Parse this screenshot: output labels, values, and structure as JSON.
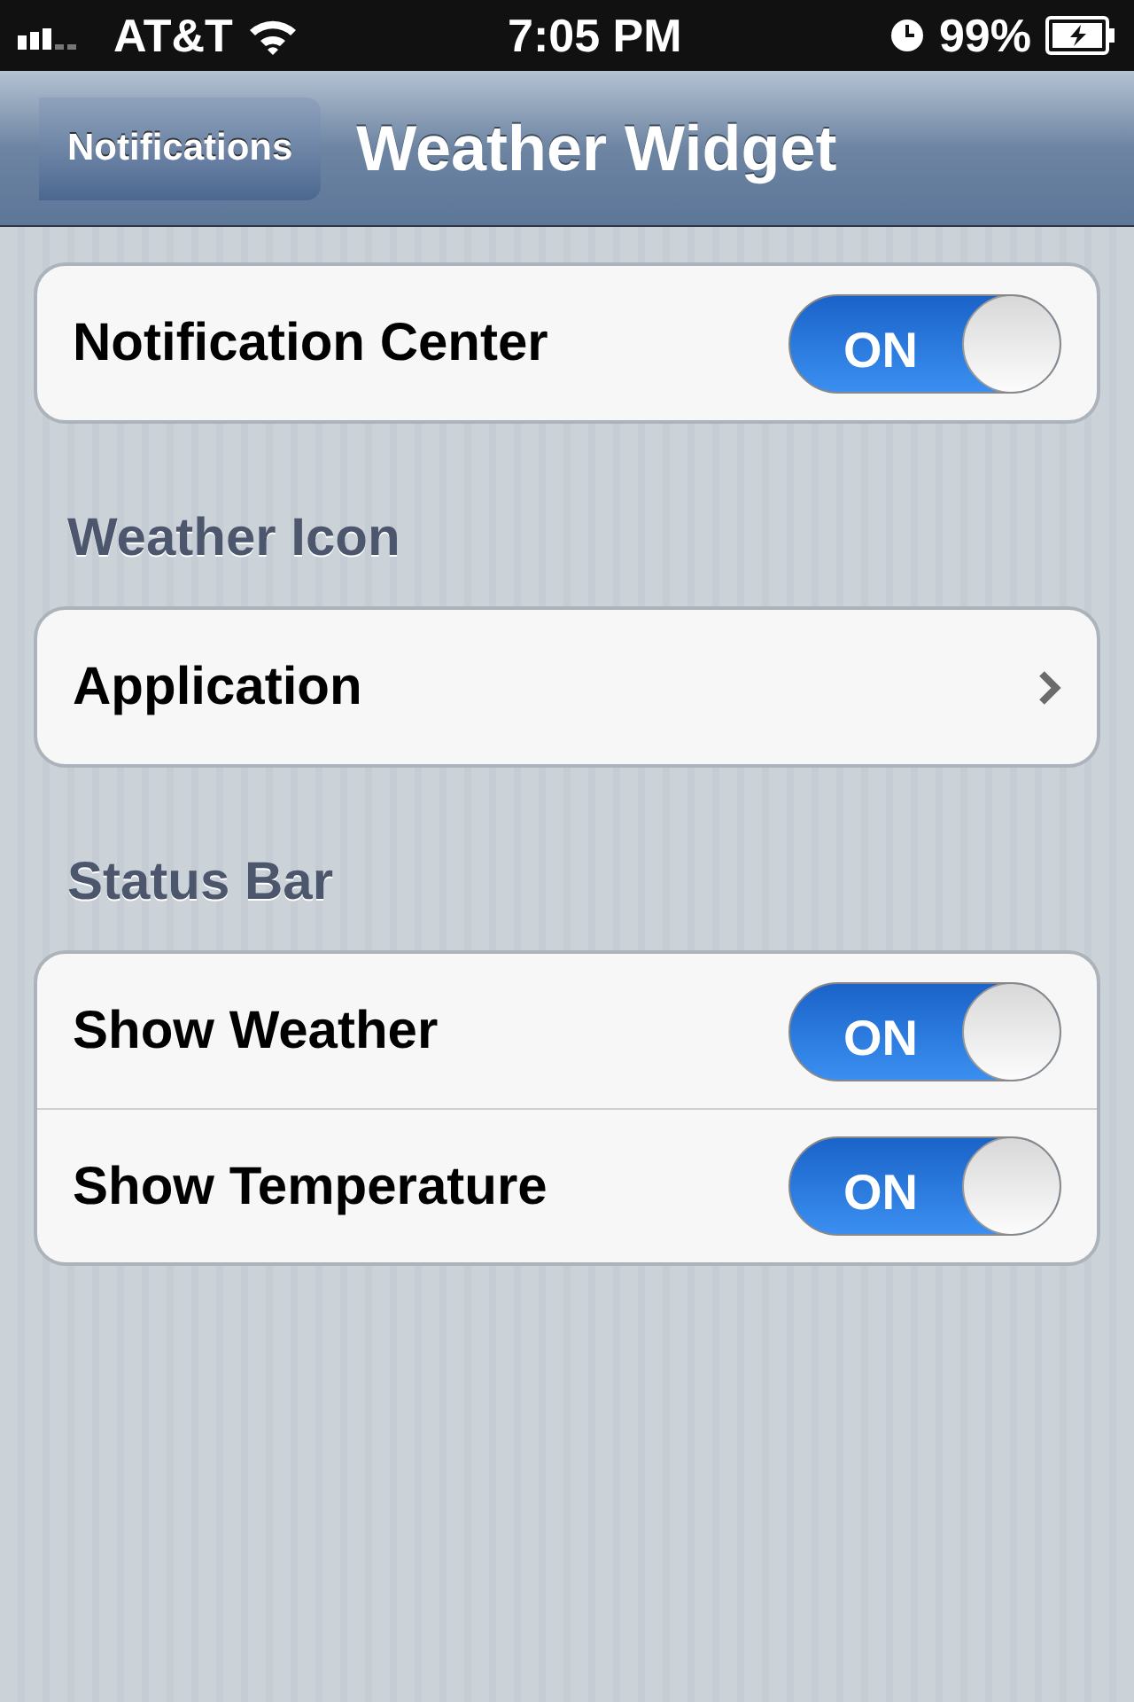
{
  "status_bar": {
    "carrier": "AT&T",
    "time": "7:05 PM",
    "battery": "99%"
  },
  "nav_bar": {
    "back": "Notifications",
    "title": "Weather Widget"
  },
  "groups": [
    {
      "rows": [
        {
          "kind": "switch",
          "label": "Notification Center",
          "on": true,
          "switch_text": "ON"
        }
      ]
    },
    {
      "header": "Weather Icon",
      "rows": [
        {
          "kind": "disclosure",
          "label": "Application"
        }
      ]
    },
    {
      "header": "Status Bar",
      "rows": [
        {
          "kind": "switch",
          "label": "Show Weather",
          "on": true,
          "switch_text": "ON"
        },
        {
          "kind": "switch",
          "label": "Show Temperature",
          "on": true,
          "switch_text": "ON"
        }
      ]
    }
  ]
}
